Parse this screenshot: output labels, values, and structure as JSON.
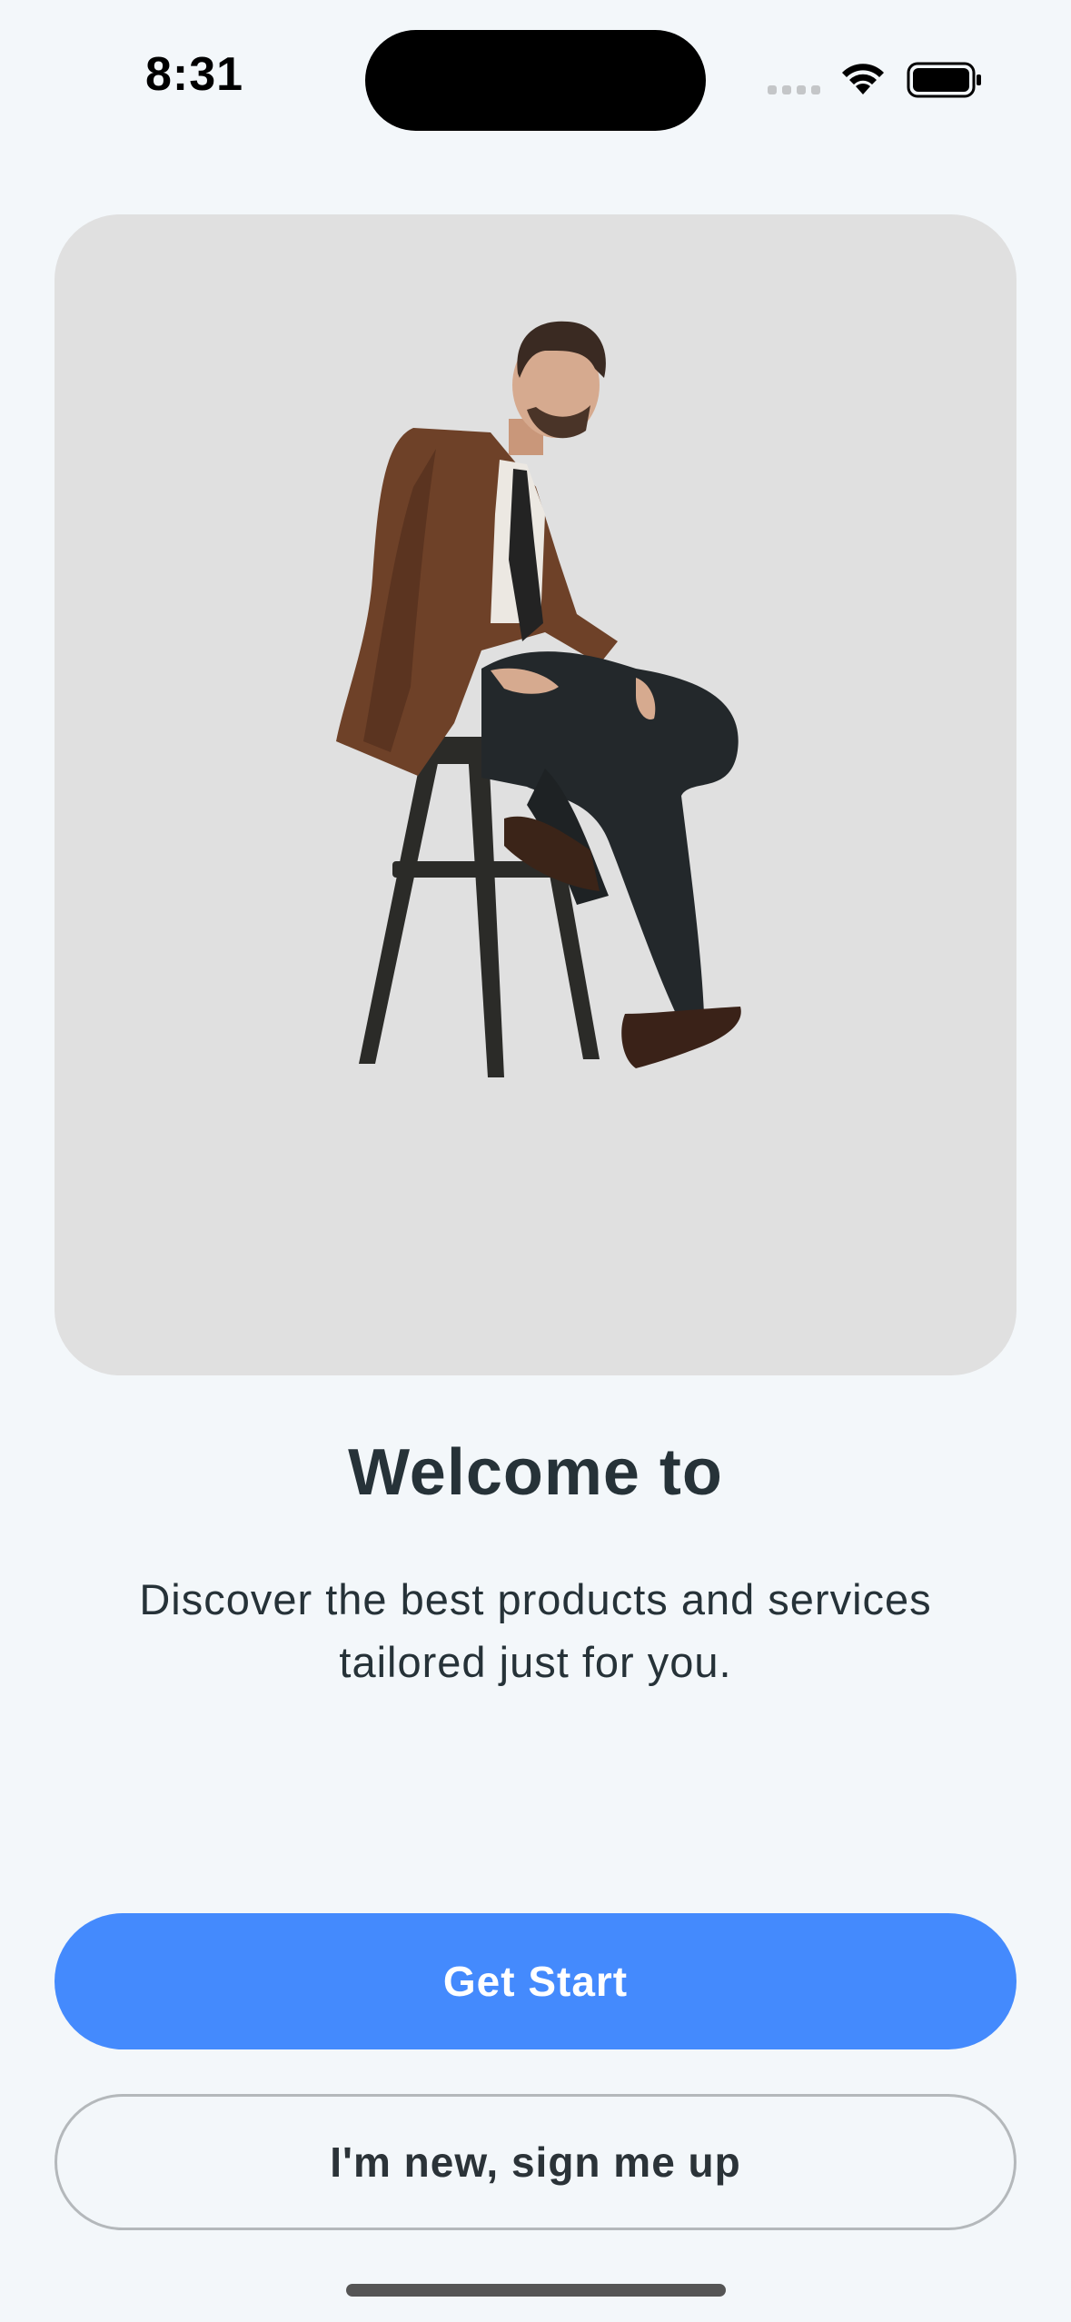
{
  "status_bar": {
    "time": "8:31",
    "icons": [
      "cellular-signal-icon",
      "wifi-icon",
      "battery-icon"
    ]
  },
  "hero": {
    "image_description_icon": "man-seated-on-stool-photo"
  },
  "welcome": {
    "title": "Welcome to",
    "subtitle": "Discover the best products and services tailored just for you."
  },
  "actions": {
    "primary_label": "Get Start",
    "secondary_label": "I'm new, sign me up"
  },
  "colors": {
    "background": "#f3f7fa",
    "primary": "#448afd",
    "text": "#263238",
    "card": "#e0e0e0"
  }
}
